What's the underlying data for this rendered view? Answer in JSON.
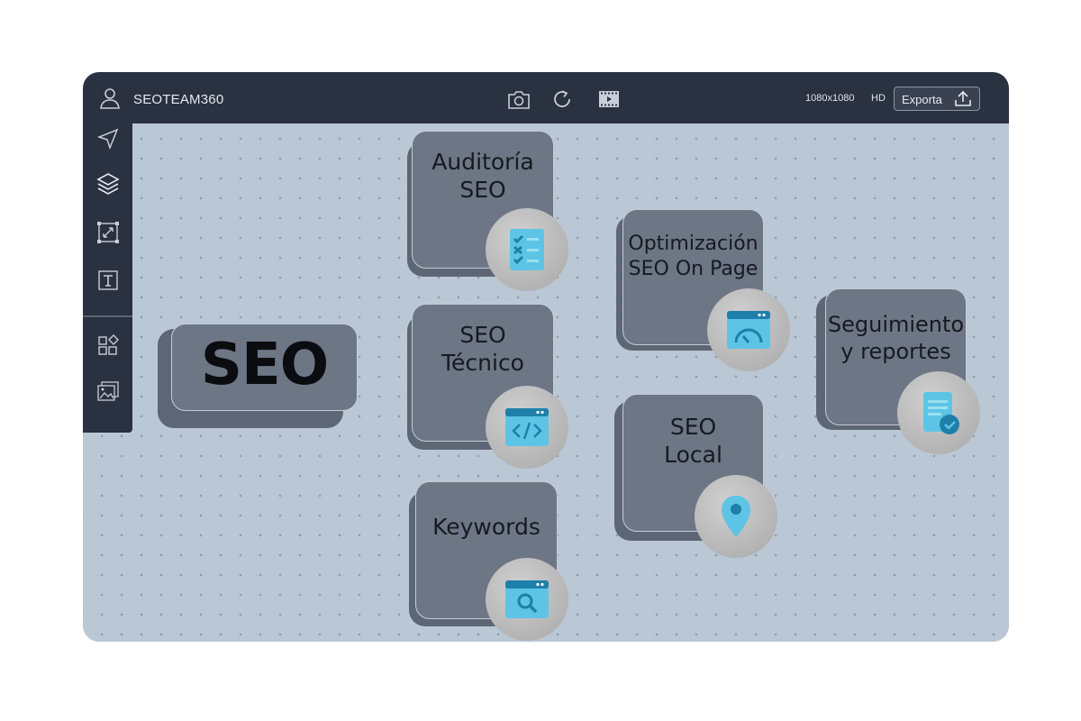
{
  "app": {
    "title": "SEOTEAM360"
  },
  "toolbar": {
    "resolution": "1080x1080",
    "quality": "HD",
    "export_label": "Exporta",
    "icons": [
      "camera-icon",
      "refresh-icon",
      "film-icon",
      "export-icon"
    ]
  },
  "sidebar": {
    "icons": [
      "navigation-arrow-icon",
      "layers-icon",
      "resize-icon",
      "text-box-icon",
      "shapes-icon",
      "image-gallery-icon"
    ]
  },
  "canvas": {
    "main_card": {
      "label": "SEO"
    },
    "cards": [
      {
        "label": "Auditoría\nSEO",
        "icon": "checklist-icon"
      },
      {
        "label": "SEO\nTécnico",
        "icon": "code-window-icon"
      },
      {
        "label": "Keywords",
        "icon": "search-window-icon"
      },
      {
        "label": "Optimización\nSEO On Page",
        "icon": "speedometer-window-icon"
      },
      {
        "label": "SEO\nLocal",
        "icon": "location-pin-icon"
      },
      {
        "label": "Seguimiento\ny reportes",
        "icon": "report-document-icon"
      }
    ]
  },
  "colors": {
    "topbar": "#2a3140",
    "canvas": "#bac7d5",
    "card": "#6d7685",
    "icon_accent": "#5ec4e6",
    "icon_dark": "#1e7fa8"
  }
}
